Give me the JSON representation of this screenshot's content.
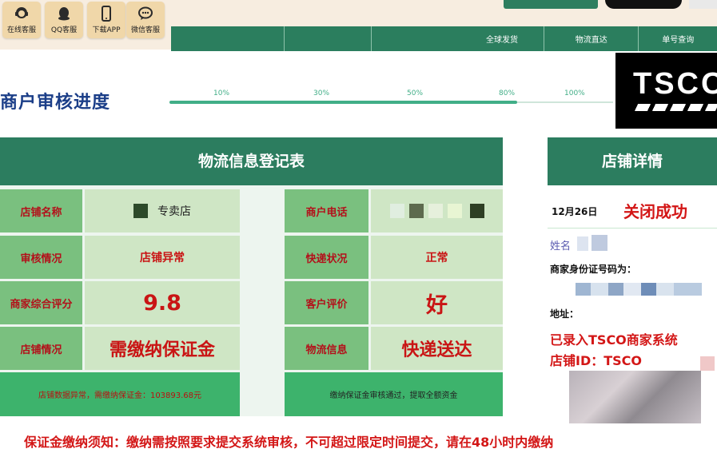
{
  "top_buttons": [
    {
      "label": "在线客服",
      "icon": "customer-service-icon"
    },
    {
      "label": "QQ客服",
      "icon": "qq-penguin-icon"
    },
    {
      "label": "下载APP",
      "icon": "mobile-phone-icon"
    },
    {
      "label": "微信客服",
      "icon": "wechat-chat-icon"
    }
  ],
  "nav": {
    "items": [
      "",
      "",
      "全球发货",
      "物流直达",
      "单号查询"
    ]
  },
  "progress": {
    "title": "商户审核进度",
    "steps": [
      "10%",
      "30%",
      "50%",
      "80%",
      "100%"
    ],
    "value_percent": 80
  },
  "logo": {
    "text": "TSCO"
  },
  "registration_table": {
    "title": "物流信息登记表",
    "rows": [
      {
        "left_label": "店铺名称",
        "left_value": "专卖店",
        "right_label": "商户电话",
        "right_value": ""
      },
      {
        "left_label": "审核情况",
        "left_value": "店铺异常",
        "right_label": "快递状况",
        "right_value": "正常"
      },
      {
        "left_label": "商家综合评分",
        "left_value": "9.8",
        "right_label": "客户评价",
        "right_value": "好"
      },
      {
        "left_label": "店铺情况",
        "left_value": "需缴纳保证金",
        "right_label": "物流信息",
        "right_value": "快递送达"
      }
    ],
    "footer_left": "店铺数据异常，需缴纳保证金：103893.68元",
    "footer_right": "缴纳保证金审核通过，提取全额资金"
  },
  "shop_details": {
    "title": "店铺详情",
    "date": "12月26日",
    "status": "关闭成功",
    "name_label": "姓名",
    "id_label": "商家身份证号码为：",
    "address_label": "地址：",
    "registered_text": "已录入TSCO商家系统",
    "shop_id_text": "店铺ID：TSCO"
  },
  "notice": "保证金缴纳须知：缴纳需按照要求提交系统审核，不可超过限定时间提交，请在48小时内缴纳",
  "colors": {
    "primary_green": "#2c7d5f",
    "label_green": "#7ac07f",
    "value_green": "#cfe6c5",
    "accent_red": "#d31616",
    "title_blue": "#1b3e88"
  }
}
